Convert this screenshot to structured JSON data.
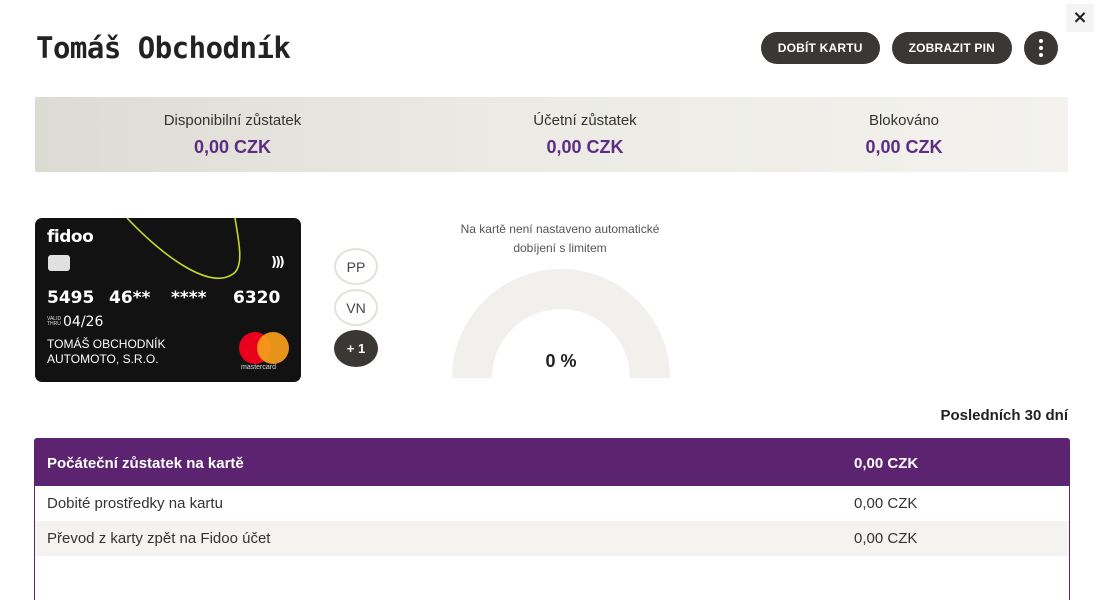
{
  "header": {
    "title": "Tomáš Obchodník",
    "topup_label": "DOBÍT KARTU",
    "pin_label": "ZOBRAZIT PIN",
    "close_symbol": "×"
  },
  "balances": [
    {
      "label": "Disponibilní zůstatek",
      "value": "0,00 CZK"
    },
    {
      "label": "Účetní zůstatek",
      "value": "0,00 CZK"
    },
    {
      "label": "Blokováno",
      "value": "0,00 CZK"
    }
  ],
  "card": {
    "brand_logo": "fidoo",
    "number_parts": [
      "5495",
      "46**",
      "****",
      "6320"
    ],
    "valid_thru_label": "VALID THRU",
    "expiry": "04/26",
    "holder_lines": [
      "TOMÁŠ OBCHODNÍK",
      "AUTOMOTO, S.R.O."
    ],
    "network": "mastercard",
    "nfc_symbol": ")))"
  },
  "badges": [
    "PP",
    "VN",
    "+ 1"
  ],
  "auto_topup": {
    "note": "Na kartě není nastaveno automatické dobíjení s limitem",
    "percent_label": "0 %",
    "fraction": 0
  },
  "period_label": "Posledních 30 dní",
  "summary_table": {
    "header": {
      "label": "Počáteční zůstatek na kartě",
      "value": "0,00 CZK"
    },
    "rows": [
      {
        "label": "Dobité prostředky na kartu",
        "value": "0,00 CZK"
      },
      {
        "label": "Převod z karty zpět na Fidoo účet",
        "value": "0,00 CZK"
      }
    ]
  },
  "colors": {
    "accent_purple": "#5c2470",
    "value_purple": "#5c2d82",
    "button_dark": "#3a3834",
    "fidoo_green": "#c6d82a"
  }
}
